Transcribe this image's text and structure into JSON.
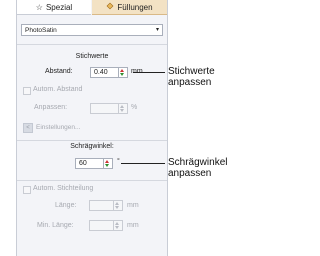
{
  "tabs": [
    {
      "label": "Spezial",
      "icon": "star-icon"
    },
    {
      "label": "Füllungen",
      "icon": "fill-icon"
    }
  ],
  "fill_type": {
    "selected": "PhotoSatin"
  },
  "stitch_values": {
    "heading": "Stichwerte",
    "spacing": {
      "label": "Abstand:",
      "value": "0.40",
      "unit": "mm"
    },
    "auto_spacing": {
      "label": "Autom. Abstand"
    },
    "adjust": {
      "label": "Anpassen:",
      "value": "",
      "unit": "%"
    },
    "settings_button": {
      "label": "Einstellungen..."
    }
  },
  "angle": {
    "heading": "Schrägwinkel:",
    "value": "60",
    "unit": "°"
  },
  "split": {
    "auto_split": {
      "label": "Autom. Stichteilung"
    },
    "length": {
      "label": "Länge:",
      "value": "",
      "unit": "mm"
    },
    "min_length": {
      "label": "Min. Länge:",
      "value": "",
      "unit": "mm"
    }
  },
  "annotations": {
    "stitch_values": [
      "Stichwerte",
      "anpassen"
    ],
    "angle": [
      "Schrägwinkel",
      "anpassen"
    ]
  },
  "colors": {
    "panel_bg": "#f3f4f8",
    "active_tab_bg": "#f3e2c4",
    "spin_up": "#cc3333",
    "spin_down": "#2f8f2f"
  }
}
